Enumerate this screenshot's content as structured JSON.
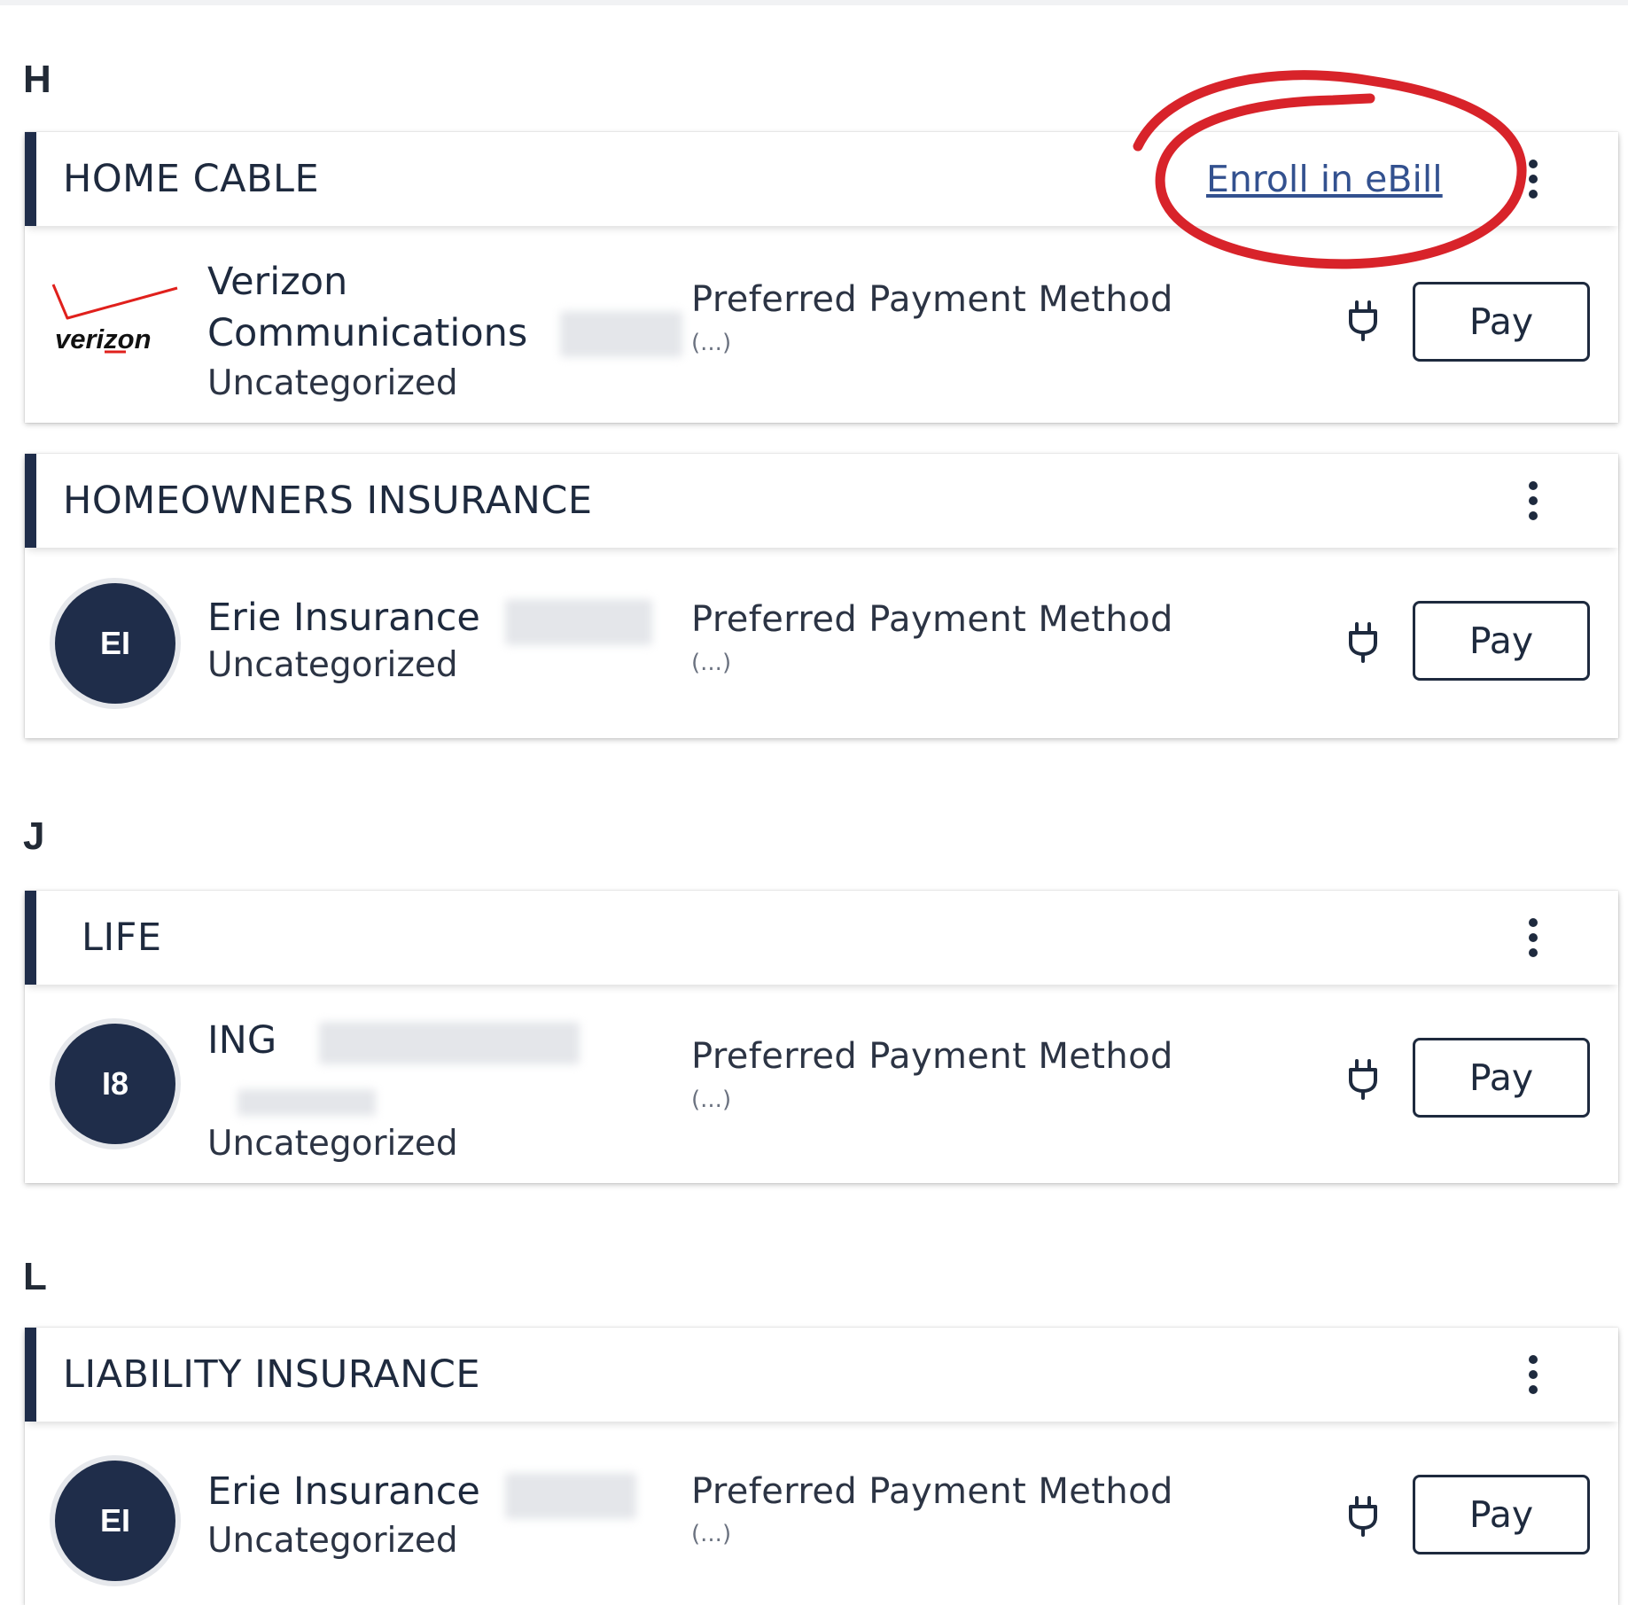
{
  "sections": [
    {
      "letter": "H",
      "cards": [
        {
          "title": "HOME CABLE",
          "enroll_link": "Enroll in eBill",
          "payee": {
            "logo": "verizon-logo",
            "name_line1": "Verizon",
            "name_line2": "Communications",
            "category": "Uncategorized",
            "payment_method_label": "Preferred Payment Method",
            "payment_method_value": "(...)",
            "pay_label": "Pay"
          }
        },
        {
          "title": "HOMEOWNERS INSURANCE",
          "payee": {
            "initials": "EI",
            "name": "Erie Insurance",
            "category": "Uncategorized",
            "payment_method_label": "Preferred Payment Method",
            "payment_method_value": "(...)",
            "pay_label": "Pay"
          }
        }
      ]
    },
    {
      "letter": "J",
      "cards": [
        {
          "title": "LIFE",
          "payee": {
            "initials": "I8",
            "name": "ING",
            "category": "Uncategorized",
            "payment_method_label": "Preferred Payment Method",
            "payment_method_value": "(...)",
            "pay_label": "Pay"
          }
        }
      ]
    },
    {
      "letter": "L",
      "cards": [
        {
          "title": "LIABILITY INSURANCE",
          "payee": {
            "initials": "EI",
            "name": "Erie Insurance",
            "category": "Uncategorized",
            "payment_method_label": "Preferred Payment Method",
            "payment_method_value": "(...)",
            "pay_label": "Pay"
          }
        }
      ]
    }
  ],
  "icons": {
    "menu": "more-vertical-icon",
    "payment": "plug-icon",
    "highlight": "red-circle-annotation"
  },
  "colors": {
    "accent": "#1f2d4a",
    "link": "#33518f",
    "annotation": "#d8232a",
    "verizon_red": "#e0201c"
  }
}
